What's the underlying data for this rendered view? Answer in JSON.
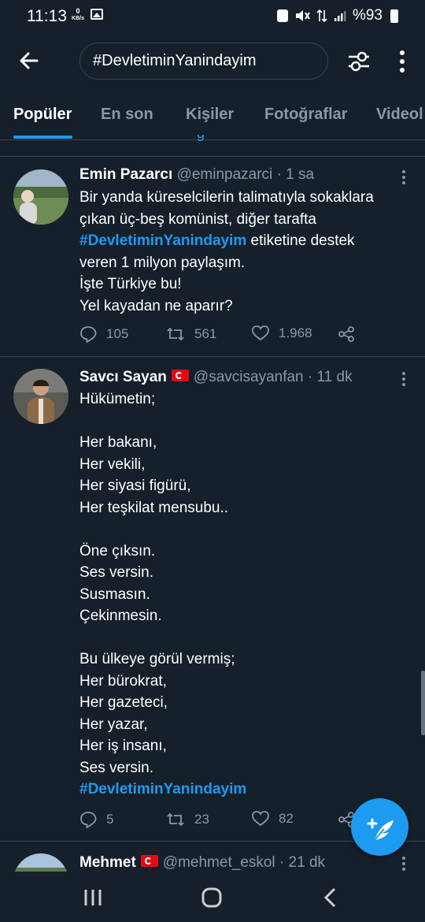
{
  "status_bar": {
    "time": "11:13",
    "kbs_value": "0",
    "kbs_unit": "KB/s",
    "battery": "%93"
  },
  "top_bar": {
    "search_query": "#DevletiminYanindayim"
  },
  "tabs": [
    {
      "label": "Popüler",
      "active": true
    },
    {
      "label": "En son",
      "active": false
    },
    {
      "label": "Kişiler",
      "active": false
    },
    {
      "label": "Fotoğraflar",
      "active": false
    },
    {
      "label": "Videol",
      "active": false
    }
  ],
  "tweets": [
    {
      "name": "Emin Pazarcı",
      "handle": "@eminpazarci",
      "time": "· 1 sa",
      "lines": [
        "Bir yanda küreselcilerin talimatıyla sokaklara",
        "çıkan üç-beş komünist, diğer tarafta",
        "İşte Türkiye bu!",
        "Yel kayadan ne aparır?"
      ],
      "hashtag": "#DevletiminYanindayim",
      "hashtag_suffix": " etiketine destek",
      "line_after_hashtag": "veren 1 milyon paylaşım.",
      "replies": "105",
      "retweets": "561",
      "likes": "1.968"
    },
    {
      "name": "Savcı Sayan",
      "handle": "@savcisayanfan",
      "time": "· 11 dk",
      "lines": [
        "Hükümetin;",
        "",
        "Her bakanı,",
        "Her vekili,",
        "Her siyasi figürü,",
        "Her teşkilat mensubu..",
        "",
        "Öne çıksın.",
        "Ses versin.",
        "Susmasın.",
        "Çekinmesin.",
        "",
        "Bu ülkeye görül vermiş;",
        "Her bürokrat,",
        "Her gazeteci,",
        "Her yazar,",
        "Her iş insanı,",
        "Ses versin."
      ],
      "hashtag": "#DevletiminYanindayim",
      "replies": "5",
      "retweets": "23",
      "likes": "82"
    },
    {
      "name": "Mehmet",
      "handle": "@mehmet_eskol",
      "time": "· 21 dk"
    }
  ],
  "colors": {
    "background": "#15202b",
    "accent": "#1d9bf0",
    "muted": "#8b98a5",
    "border": "#38444d"
  }
}
